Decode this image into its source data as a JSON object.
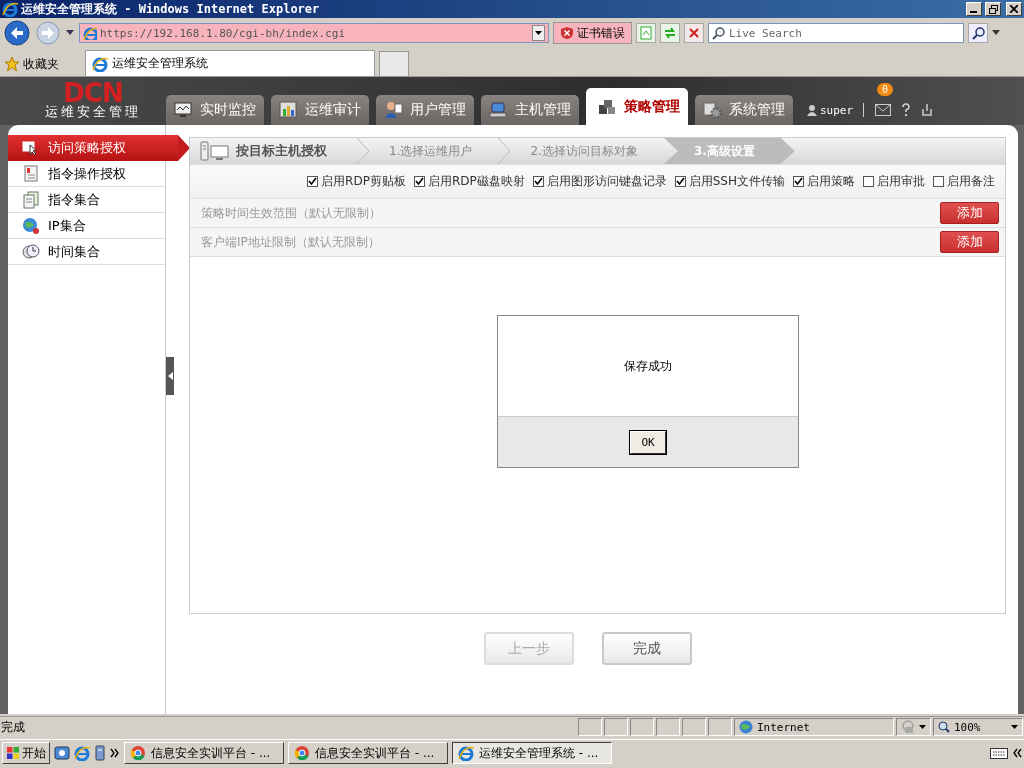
{
  "browser": {
    "title": "运维安全管理系统 - Windows Internet Explorer",
    "url": "https://192.168.1.80/cgi-bh/index.cgi",
    "certificate_error": "证书错误",
    "search": {
      "placeholder": "Live Search"
    },
    "favorites": "收藏夹",
    "tab_title": "运维安全管理系统"
  },
  "header": {
    "logo": "DCN",
    "logo_subtitle": "运维安全管理",
    "user": "super",
    "mail_count": "0",
    "tabs": [
      {
        "label": "实时监控",
        "selected": false
      },
      {
        "label": "运维审计",
        "selected": false
      },
      {
        "label": "用户管理",
        "selected": false
      },
      {
        "label": "主机管理",
        "selected": false
      },
      {
        "label": "策略管理",
        "selected": true
      },
      {
        "label": "系统管理",
        "selected": false
      }
    ]
  },
  "sidebar": {
    "items": [
      {
        "label": "访问策略授权",
        "selected": true
      },
      {
        "label": "指令操作授权",
        "selected": false
      },
      {
        "label": "指令集合",
        "selected": false
      },
      {
        "label": "IP集合",
        "selected": false
      },
      {
        "label": "时间集合",
        "selected": false
      }
    ]
  },
  "wizard": {
    "title": "按目标主机授权",
    "steps": [
      {
        "label": "1.选择运维用户",
        "selected": false
      },
      {
        "label": "2.选择访问目标对象",
        "selected": false
      },
      {
        "label": "3.高级设置",
        "selected": true
      }
    ]
  },
  "options": [
    {
      "label": "启用RDP剪贴板",
      "checked": true
    },
    {
      "label": "启用RDP磁盘映射",
      "checked": true
    },
    {
      "label": "启用图形访问键盘记录",
      "checked": true
    },
    {
      "label": "启用SSH文件传输",
      "checked": true
    },
    {
      "label": "启用策略",
      "checked": true
    },
    {
      "label": "启用审批",
      "checked": false
    },
    {
      "label": "启用备注",
      "checked": false
    }
  ],
  "rules": [
    {
      "label": "策略时间生效范围（默认无限制）",
      "button": "添加"
    },
    {
      "label": "客户端IP地址限制（默认无限制）",
      "button": "添加"
    }
  ],
  "dialog": {
    "message": "保存成功",
    "button": "OK"
  },
  "actions": [
    {
      "label": "上一步",
      "disabled": true
    },
    {
      "label": "完成",
      "disabled": false
    }
  ],
  "status_bar": {
    "text": "完成",
    "zone": "Internet",
    "zoom": "100%"
  },
  "taskbar": {
    "start": "开始",
    "tasks": [
      {
        "label": "信息安全实训平台 - ...",
        "selected": false
      },
      {
        "label": "信息安全实训平台 - ...",
        "selected": false
      },
      {
        "label": "运维安全管理系统 - ...",
        "selected": true
      }
    ]
  }
}
